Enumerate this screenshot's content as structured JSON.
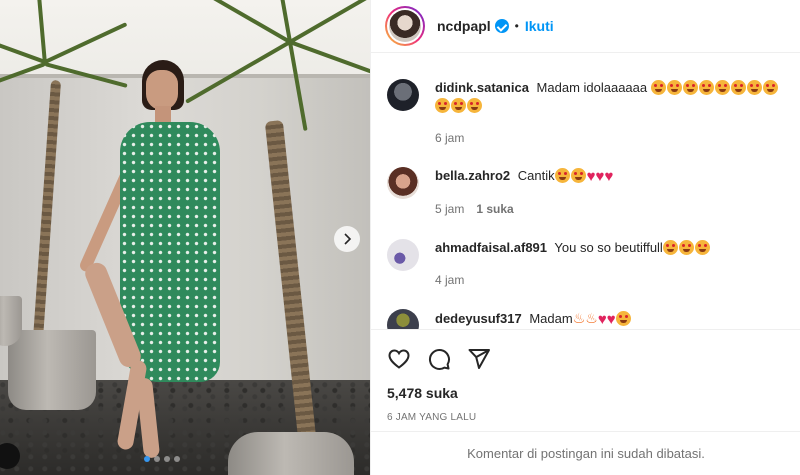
{
  "header": {
    "username": "ncdpapl",
    "separator": "•",
    "follow_label": "Ikuti"
  },
  "comments": [
    {
      "username": "didink.satanica",
      "text": "Madam idolaaaaaa",
      "emoji": [
        "star-struck",
        "star-struck",
        "star-struck",
        "star-struck",
        "star-struck",
        "star-struck",
        "star-struck",
        "star-struck",
        "star-struck",
        "star-struck",
        "star-struck"
      ],
      "time": "6 jam",
      "likes": ""
    },
    {
      "username": "bella.zahro2",
      "text": "Cantik",
      "emoji": [
        "star-struck",
        "star-struck",
        "heart",
        "heart",
        "heart"
      ],
      "time": "5 jam",
      "likes": "1 suka"
    },
    {
      "username": "ahmadfaisal.af891",
      "text": "You so so beutiffull",
      "emoji": [
        "star-struck",
        "star-struck",
        "star-struck"
      ],
      "time": "4 jam",
      "likes": ""
    },
    {
      "username": "dedeyusuf317",
      "text": "Madam",
      "emoji": [
        "fire",
        "fire",
        "heart",
        "heart",
        "star-struck"
      ],
      "time": "",
      "likes": ""
    }
  ],
  "actions": {
    "likes": "5,478 suka",
    "posted": "6 JAM YANG LALU"
  },
  "footer": {
    "disabled_text": "Komentar di postingan ini sudah dibatasi."
  },
  "carousel": {
    "slide_count": 4,
    "active_index": 0
  },
  "colors": {
    "link_blue": "#0095f6",
    "heart_red": "#e0245e",
    "dress_green": "#2f8a5c"
  }
}
